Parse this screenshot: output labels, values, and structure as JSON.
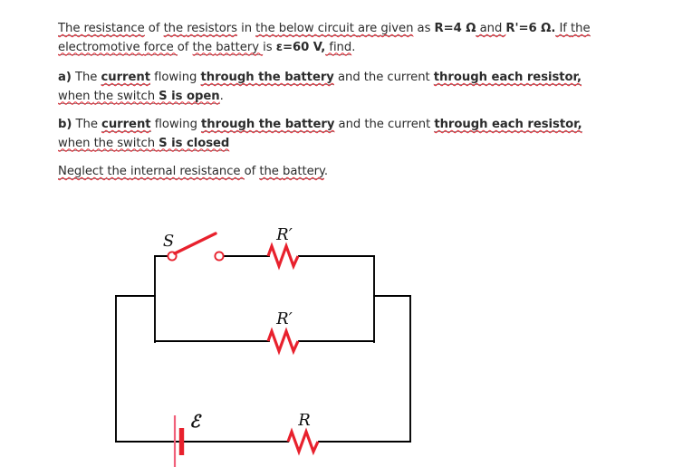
{
  "document": {
    "paragraphs": [
      {
        "id": "intro",
        "runs": [
          {
            "t": "The ",
            "style": "spell"
          },
          {
            "t": "resistance",
            "style": "spell"
          },
          {
            "t": " of ",
            "style": "plain"
          },
          {
            "t": "the ",
            "style": "spell"
          },
          {
            "t": "resistors",
            "style": "spell"
          },
          {
            "t": " in ",
            "style": "plain"
          },
          {
            "t": "the ",
            "style": "spell"
          },
          {
            "t": "below ",
            "style": "spell"
          },
          {
            "t": "circuit ",
            "style": "spell"
          },
          {
            "t": "are ",
            "style": "spell"
          },
          {
            "t": "given",
            "style": "spell"
          },
          {
            "t": " as ",
            "style": "plain"
          },
          {
            "t": "R=4 Ω",
            "style": "bold"
          },
          {
            "t": " and ",
            "style": "spell"
          },
          {
            "t": "R'=6 Ω.",
            "style": "bold"
          },
          {
            "t": "  If ",
            "style": "spell"
          },
          {
            "t": "the ",
            "style": "spell"
          },
          {
            "t": "electromotive ",
            "style": "spell"
          },
          {
            "t": "force ",
            "style": "spell"
          },
          {
            "t": "of ",
            "style": "plain"
          },
          {
            "t": "the ",
            "style": "spell"
          },
          {
            "t": "battery ",
            "style": "spell"
          },
          {
            "t": "is ",
            "style": "plain"
          },
          {
            "t": "ε=60 V,",
            "style": "bold"
          },
          {
            "t": " find",
            "style": "spell"
          },
          {
            "t": ".",
            "style": "plain"
          }
        ]
      },
      {
        "id": "part-a",
        "marker": "a)",
        "runs": [
          {
            "t": "  The ",
            "style": "plain"
          },
          {
            "t": "current",
            "style": "boldspell"
          },
          {
            "t": " flowing ",
            "style": "plain"
          },
          {
            "t": "through the battery",
            "style": "boldspell"
          },
          {
            "t": " and the current ",
            "style": "plain"
          },
          {
            "t": "through each resistor,",
            "style": "boldspell"
          },
          {
            "t": " when ",
            "style": "spell"
          },
          {
            "t": "the ",
            "style": "spell"
          },
          {
            "t": "switch ",
            "style": "spell"
          },
          {
            "t": "S is open",
            "style": "boldspell"
          },
          {
            "t": ".",
            "style": "plain"
          }
        ]
      },
      {
        "id": "part-b",
        "marker": "b)",
        "runs": [
          {
            "t": "   The ",
            "style": "plain"
          },
          {
            "t": "current",
            "style": "boldspell"
          },
          {
            "t": " flowing ",
            "style": "plain"
          },
          {
            "t": "through the battery",
            "style": "boldspell"
          },
          {
            "t": " and the current ",
            "style": "plain"
          },
          {
            "t": "through each resistor,",
            "style": "boldspell"
          },
          {
            "t": " when ",
            "style": "spell"
          },
          {
            "t": "the ",
            "style": "spell"
          },
          {
            "t": "switch ",
            "style": "spell"
          },
          {
            "t": "S is closed",
            "style": "boldspell"
          }
        ]
      },
      {
        "id": "note",
        "runs": [
          {
            "t": "Neglect ",
            "style": "spell"
          },
          {
            "t": "the ",
            "style": "spell"
          },
          {
            "t": "internal ",
            "style": "spell"
          },
          {
            "t": "resistance ",
            "style": "spell"
          },
          {
            "t": "of ",
            "style": "plain"
          },
          {
            "t": "the ",
            "style": "spell"
          },
          {
            "t": "battery",
            "style": "spell"
          },
          {
            "t": ".",
            "style": "plain"
          }
        ]
      }
    ]
  },
  "circuit": {
    "labels": {
      "switch": "S",
      "resistor_top": "R′",
      "resistor_middle": "R′",
      "resistor_bottom": "R",
      "battery": "ℰ"
    },
    "colors": {
      "wire": "#000000",
      "component": "#e8212d",
      "label": "#111111"
    },
    "components": [
      {
        "name": "switch-S",
        "type": "switch",
        "state": "open"
      },
      {
        "name": "resistor-R-prime-top",
        "type": "resistor",
        "value": "R'"
      },
      {
        "name": "resistor-R-prime-middle",
        "type": "resistor",
        "value": "R'"
      },
      {
        "name": "resistor-R-bottom",
        "type": "resistor",
        "value": "R"
      },
      {
        "name": "battery-emf",
        "type": "battery",
        "value": "ε"
      }
    ]
  }
}
